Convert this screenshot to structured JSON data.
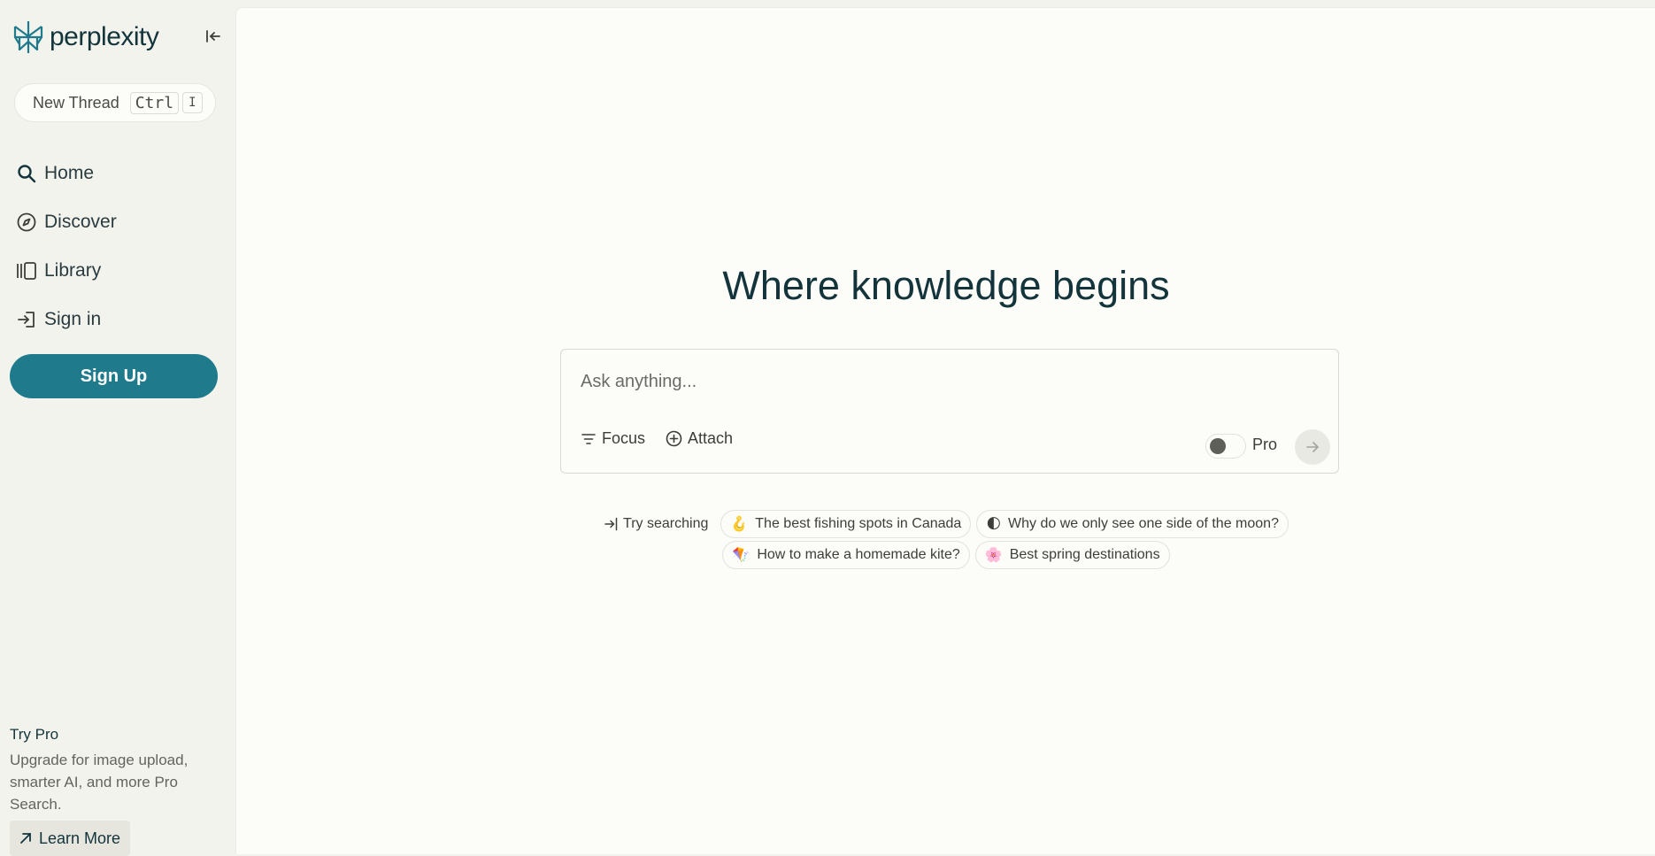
{
  "brand": {
    "name": "perplexity"
  },
  "sidebar": {
    "new_thread": {
      "label": "New Thread",
      "key1": "Ctrl",
      "key2": "I"
    },
    "nav": [
      {
        "label": "Home",
        "icon": "search-icon"
      },
      {
        "label": "Discover",
        "icon": "compass-icon"
      },
      {
        "label": "Library",
        "icon": "library-icon"
      },
      {
        "label": "Sign in",
        "icon": "sign-in-icon"
      }
    ],
    "signup_label": "Sign Up",
    "trypro": {
      "title": "Try Pro",
      "description": "Upgrade for image upload, smarter AI, and more Pro Search.",
      "learn_more": "Learn More"
    }
  },
  "main": {
    "heading": "Where knowledge begins",
    "search": {
      "placeholder": "Ask anything...",
      "focus_label": "Focus",
      "attach_label": "Attach",
      "pro_label": "Pro"
    },
    "suggestions": {
      "try_label": "Try searching",
      "items": [
        {
          "emoji": "🪝",
          "label": "The best fishing spots in Canada"
        },
        {
          "emoji": "🌓",
          "label": "Why do we only see one side of the moon?"
        },
        {
          "emoji": "🪁",
          "label": "How to make a homemade kite?"
        },
        {
          "emoji": "🌸",
          "label": "Best spring destinations"
        }
      ]
    }
  },
  "colors": {
    "accent": "#1f7a8c",
    "text": "#13343b",
    "background": "#fcfcf9",
    "sidebar": "#f3f3ee"
  }
}
